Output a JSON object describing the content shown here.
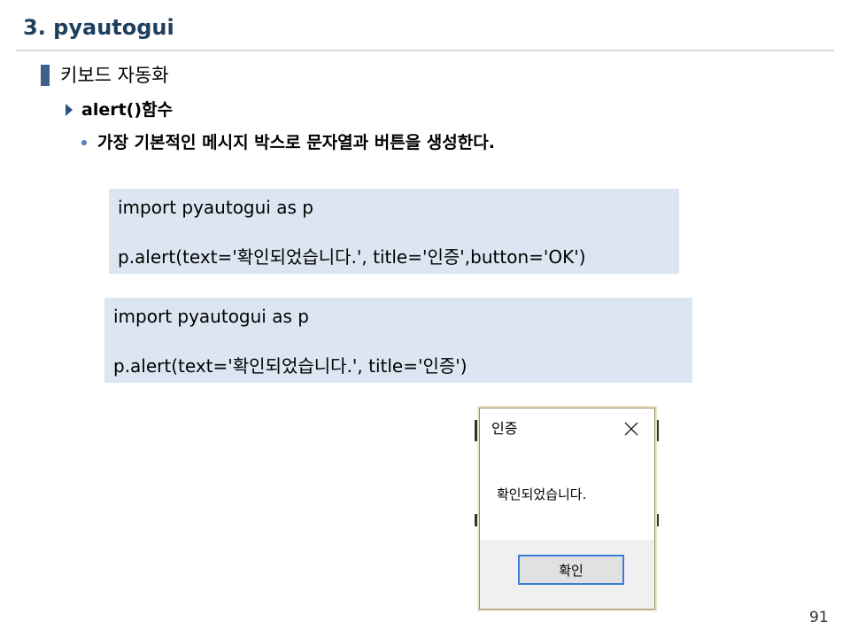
{
  "slide": {
    "title": "3. pyautogui",
    "section": "키보드 자동화",
    "subsection": "alert()함수",
    "bullet": "가장 기본적인 메시지 박스로 문자열과 버튼을 생성한다.",
    "page_number": "91"
  },
  "code_block_1": {
    "line1": "import pyautogui as p",
    "line2": "p.alert(text='확인되었습니다.', title='인증',button='OK')"
  },
  "code_block_2": {
    "line1": "import pyautogui as p",
    "line2": "p.alert(text='확인되었습니다.', title='인증')"
  },
  "dialog": {
    "title": "인증",
    "message": "확인되었습니다.",
    "ok_label": "확인",
    "close_icon": "close-icon"
  },
  "colors": {
    "title": "#1f3f5f",
    "code_background": "#dce6f2",
    "accent": "#3f5f8f",
    "button_border": "#3c7fd8"
  }
}
